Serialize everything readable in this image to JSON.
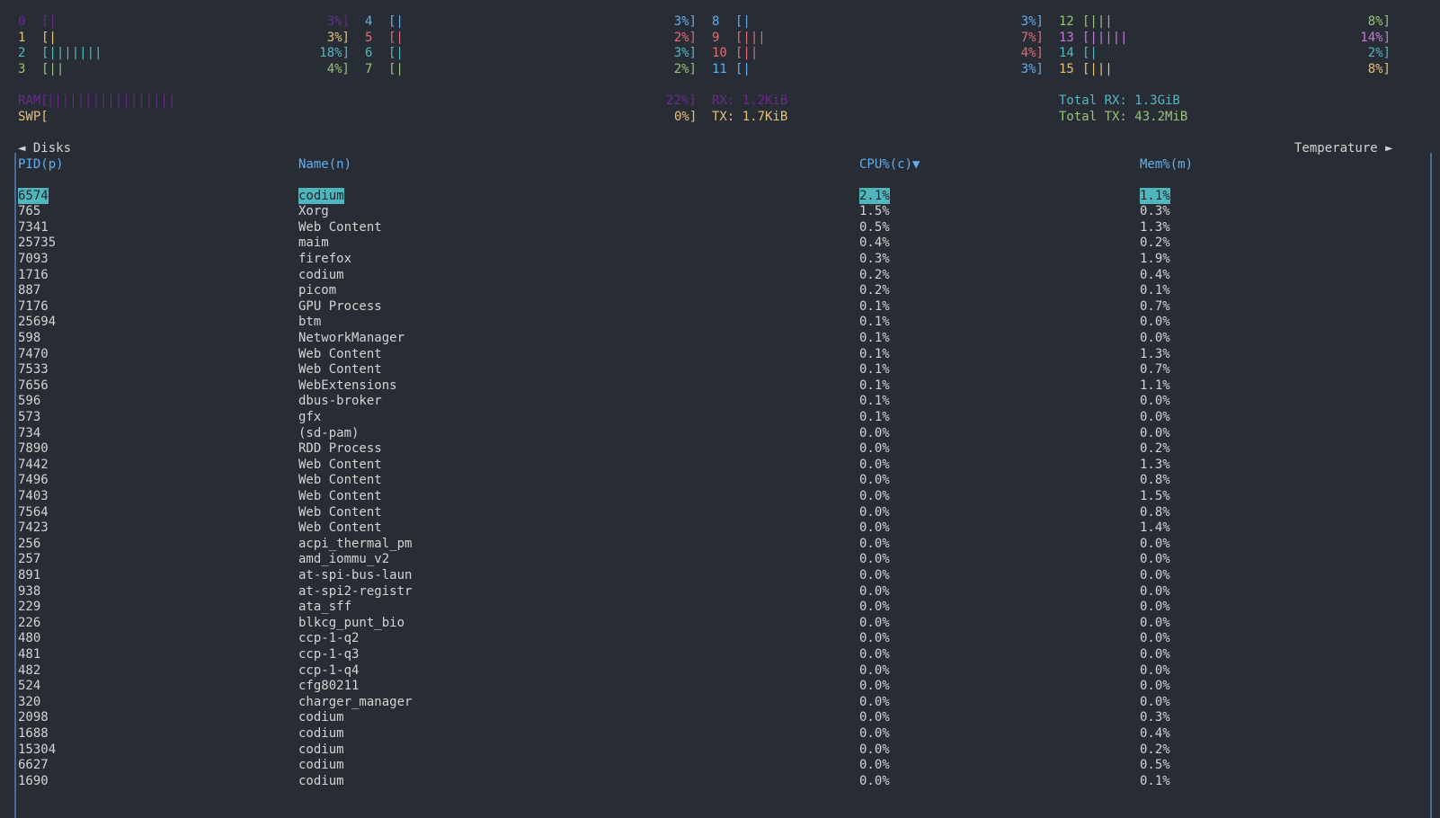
{
  "cpu_cores": [
    {
      "id": "0",
      "bar": "[|",
      "pct": "3%]",
      "color": "#6a2a8e"
    },
    {
      "id": "1",
      "bar": "[|",
      "pct": "3%]",
      "color": "#e6c07b"
    },
    {
      "id": "2",
      "bar": "[|||||||",
      "pct": "18%]",
      "color": "#56b6c2"
    },
    {
      "id": "3",
      "bar": "[||",
      "pct": "4%]",
      "color": "#98c379"
    },
    {
      "id": "4",
      "bar": "[|",
      "pct": "3%]",
      "color": "#61afef"
    },
    {
      "id": "5",
      "bar": "[|",
      "pct": "2%]",
      "color": "#e06c75"
    },
    {
      "id": "6",
      "bar": "[|",
      "pct": "3%]",
      "color": "#56b6c2"
    },
    {
      "id": "7",
      "bar": "[|",
      "pct": "2%]",
      "color": "#98c379"
    },
    {
      "id": "8",
      "bar": "[|",
      "pct": "3%]",
      "color": "#61afef"
    },
    {
      "id": "9",
      "bar": "[|||",
      "pct": "7%]",
      "color": "#e06c75"
    },
    {
      "id": "10",
      "bar": "[||",
      "pct": "4%]",
      "color": "#e06c75"
    },
    {
      "id": "11",
      "bar": "[|",
      "pct": "3%]",
      "color": "#61afef"
    },
    {
      "id": "12",
      "bar": "[|||",
      "pct": "8%]",
      "color": "#98c379"
    },
    {
      "id": "13",
      "bar": "[|||||",
      "pct": "14%]",
      "color": "#c678dd"
    },
    {
      "id": "14",
      "bar": "[|",
      "pct": "2%]",
      "color": "#56b6c2"
    },
    {
      "id": "15",
      "bar": "[|||",
      "pct": "8%]",
      "color": "#e6c07b"
    }
  ],
  "memory": {
    "ram_label": "RAM[",
    "ram_bar": "|||||||||||||||||",
    "ram_pct": "22%]",
    "ram_color": "#6a2a8e",
    "swp_label": "SWP[",
    "swp_pct": "0%]",
    "swp_color": "#e6c07b"
  },
  "network": {
    "rx": "RX: 1.2KiB",
    "tx": "TX: 1.7KiB",
    "total_rx": "Total RX: 1.3GiB",
    "total_tx": "Total TX: 43.2MiB",
    "rx_color": "#6a2a8e",
    "tx_color": "#e6c07b",
    "total_rx_color": "#56b6c2",
    "total_tx_color": "#98c379"
  },
  "widget_nav": {
    "left": "◄ Disks",
    "right": "Temperature ►"
  },
  "process_table": {
    "headers": {
      "pid": "PID(p)",
      "name": "Name(n)",
      "cpu": "CPU%(c)▼",
      "mem": "Mem%(m)"
    },
    "header_color": "#61afef",
    "highlight_color": "#4fb6bd",
    "rows": [
      [
        "6574",
        "codium",
        "2.1%",
        "1.1%"
      ],
      [
        "765",
        "Xorg",
        "1.5%",
        "0.3%"
      ],
      [
        "7341",
        "Web Content",
        "0.5%",
        "1.3%"
      ],
      [
        "25735",
        "maim",
        "0.4%",
        "0.2%"
      ],
      [
        "7093",
        "firefox",
        "0.3%",
        "1.9%"
      ],
      [
        "1716",
        "codium",
        "0.2%",
        "0.4%"
      ],
      [
        "887",
        "picom",
        "0.2%",
        "0.1%"
      ],
      [
        "7176",
        "GPU Process",
        "0.1%",
        "0.7%"
      ],
      [
        "25694",
        "btm",
        "0.1%",
        "0.0%"
      ],
      [
        "598",
        "NetworkManager",
        "0.1%",
        "0.0%"
      ],
      [
        "7470",
        "Web Content",
        "0.1%",
        "1.3%"
      ],
      [
        "7533",
        "Web Content",
        "0.1%",
        "0.7%"
      ],
      [
        "7656",
        "WebExtensions",
        "0.1%",
        "1.1%"
      ],
      [
        "596",
        "dbus-broker",
        "0.1%",
        "0.0%"
      ],
      [
        "573",
        "gfx",
        "0.1%",
        "0.0%"
      ],
      [
        "734",
        "(sd-pam)",
        "0.0%",
        "0.0%"
      ],
      [
        "7890",
        "RDD Process",
        "0.0%",
        "0.2%"
      ],
      [
        "7442",
        "Web Content",
        "0.0%",
        "1.3%"
      ],
      [
        "7496",
        "Web Content",
        "0.0%",
        "0.8%"
      ],
      [
        "7403",
        "Web Content",
        "0.0%",
        "1.5%"
      ],
      [
        "7564",
        "Web Content",
        "0.0%",
        "0.8%"
      ],
      [
        "7423",
        "Web Content",
        "0.0%",
        "1.4%"
      ],
      [
        "256",
        "acpi_thermal_pm",
        "0.0%",
        "0.0%"
      ],
      [
        "257",
        "amd_iommu_v2",
        "0.0%",
        "0.0%"
      ],
      [
        "891",
        "at-spi-bus-laun",
        "0.0%",
        "0.0%"
      ],
      [
        "938",
        "at-spi2-registr",
        "0.0%",
        "0.0%"
      ],
      [
        "229",
        "ata_sff",
        "0.0%",
        "0.0%"
      ],
      [
        "226",
        "blkcg_punt_bio",
        "0.0%",
        "0.0%"
      ],
      [
        "480",
        "ccp-1-q2",
        "0.0%",
        "0.0%"
      ],
      [
        "481",
        "ccp-1-q3",
        "0.0%",
        "0.0%"
      ],
      [
        "482",
        "ccp-1-q4",
        "0.0%",
        "0.0%"
      ],
      [
        "524",
        "cfg80211",
        "0.0%",
        "0.0%"
      ],
      [
        "320",
        "charger_manager",
        "0.0%",
        "0.0%"
      ],
      [
        "2098",
        "codium",
        "0.0%",
        "0.3%"
      ],
      [
        "1688",
        "codium",
        "0.0%",
        "0.4%"
      ],
      [
        "15304",
        "codium",
        "0.0%",
        "0.2%"
      ],
      [
        "6627",
        "codium",
        "0.0%",
        "0.5%"
      ],
      [
        "1690",
        "codium",
        "0.0%",
        "0.1%"
      ]
    ]
  }
}
